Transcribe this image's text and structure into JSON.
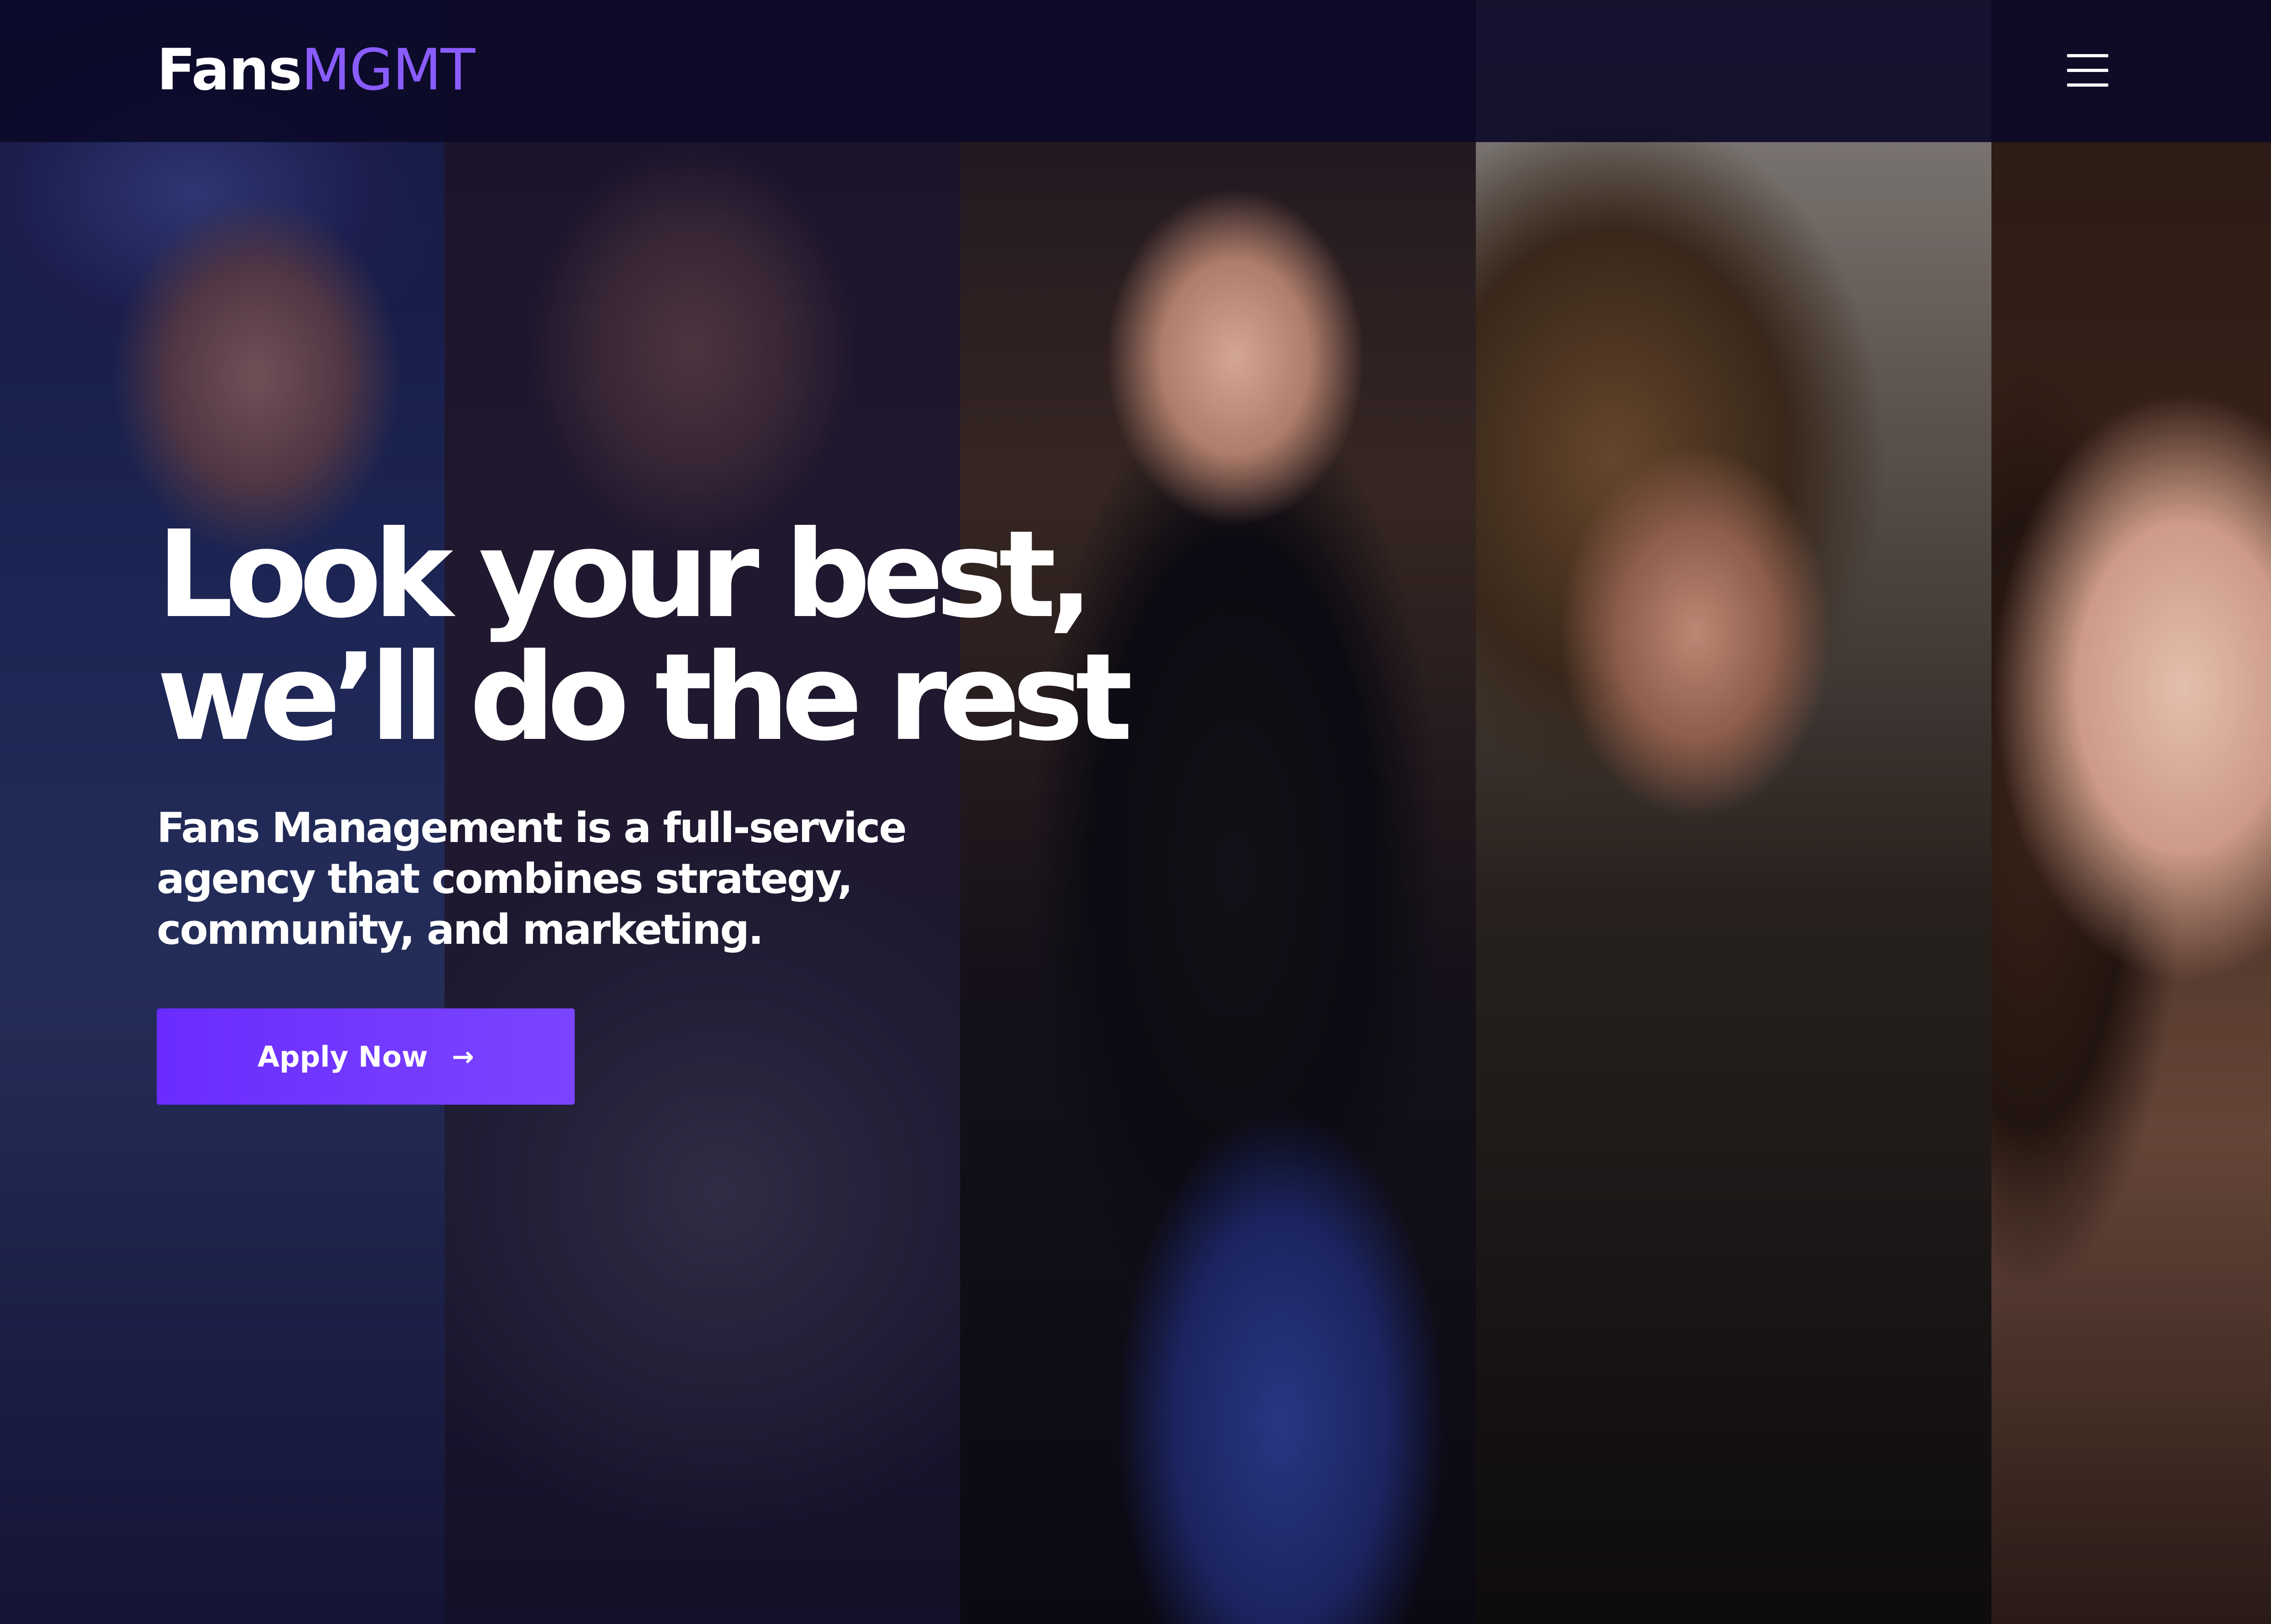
{
  "header": {
    "logo": {
      "part1": "Fans",
      "part2": "MGMT"
    },
    "menu_icon": "hamburger-menu-icon"
  },
  "hero": {
    "title_line1": "Look your best,",
    "title_line2": "we’ll do the rest",
    "subtitle": "Fans Management is a full-service agency that combines strategy, community, and marketing.",
    "cta_label": "Apply Now",
    "cta_icon": "arrow-right-icon",
    "cta_arrow": "→"
  },
  "colors": {
    "brand_accent": "#8a5cff",
    "cta_background": "#6a2cff",
    "header_background": "#0c0a28",
    "text": "#ffffff"
  },
  "gallery": {
    "panels": [
      {
        "image": "portrait-photo-1"
      },
      {
        "image": "portrait-photo-2"
      },
      {
        "image": "portrait-photo-3"
      },
      {
        "image": "portrait-photo-4"
      },
      {
        "image": "portrait-photo-5"
      }
    ]
  }
}
